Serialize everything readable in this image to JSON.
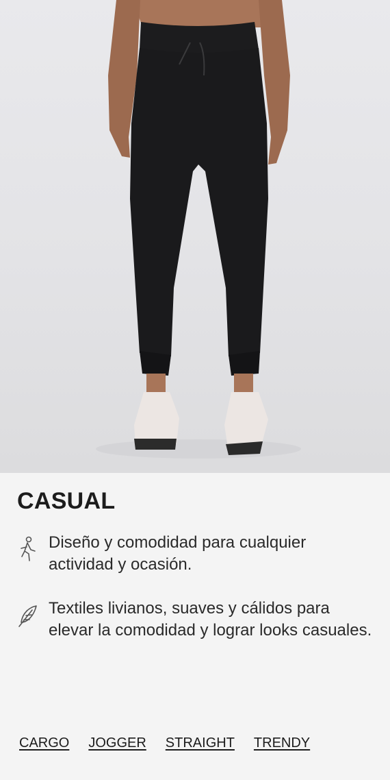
{
  "hero": {
    "image_alt": "Modelo con pantalón jogger negro y zapatillas blancas"
  },
  "category": {
    "title": "CASUAL"
  },
  "features": [
    {
      "icon": "walking-person-icon",
      "text": "Diseño y comodidad para cualquier actividad y ocasión."
    },
    {
      "icon": "feather-icon",
      "text": "Textiles livianos, suaves y cálidos para elevar la comodidad y lograr looks casuales."
    }
  ],
  "tags": [
    "CARGO",
    "JOGGER",
    "STRAIGHT",
    "TRENDY"
  ],
  "colors": {
    "background": "#f4f4f4",
    "text": "#1c1c1c",
    "pants": "#1a1a1c"
  }
}
